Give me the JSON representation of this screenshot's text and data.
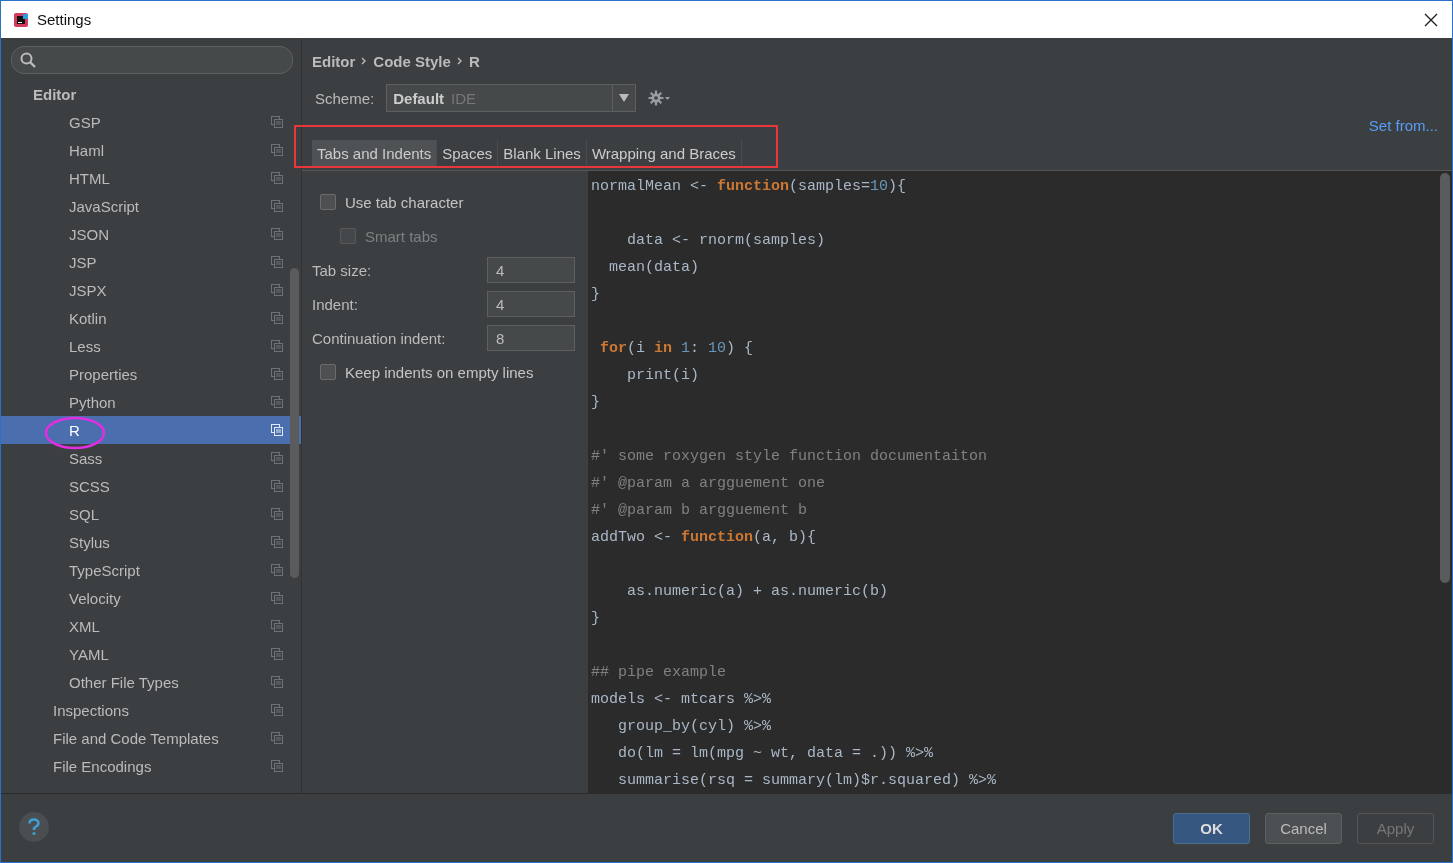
{
  "window": {
    "title": "Settings"
  },
  "sidebar": {
    "tree": [
      {
        "label": "Editor",
        "selected": false,
        "children": [
          {
            "children": [
              {
                "label": "GSP",
                "selected": false
              },
              {
                "label": "Haml",
                "selected": false
              },
              {
                "label": "HTML",
                "selected": false
              },
              {
                "label": "JavaScript",
                "selected": false
              },
              {
                "label": "JSON",
                "selected": false
              },
              {
                "label": "JSP",
                "selected": false
              },
              {
                "label": "JSPX",
                "selected": false
              },
              {
                "label": "Kotlin",
                "selected": false
              },
              {
                "label": "Less",
                "selected": false
              },
              {
                "label": "Properties",
                "selected": false
              },
              {
                "label": "Python",
                "selected": false
              },
              {
                "label": "R",
                "selected": true
              },
              {
                "label": "Sass",
                "selected": false
              },
              {
                "label": "SCSS",
                "selected": false
              },
              {
                "label": "SQL",
                "selected": false
              },
              {
                "label": "Stylus",
                "selected": false
              },
              {
                "label": "TypeScript",
                "selected": false
              },
              {
                "label": "Velocity",
                "selected": false
              },
              {
                "label": "XML",
                "selected": false
              },
              {
                "label": "YAML",
                "selected": false
              },
              {
                "label": "Other File Types",
                "selected": false
              }
            ]
          },
          {
            "label": "Inspections",
            "selected": false
          },
          {
            "label": "File and Code Templates",
            "selected": false
          },
          {
            "label": "File Encodings",
            "selected": false
          }
        ]
      }
    ]
  },
  "breadcrumb": [
    "Editor",
    "Code Style",
    "R"
  ],
  "scheme": {
    "label": "Scheme:",
    "value": "Default",
    "hint": "IDE"
  },
  "set_from": "Set from...",
  "tabs": [
    {
      "label": "Tabs and Indents",
      "selected": true
    },
    {
      "label": "Spaces",
      "selected": false
    },
    {
      "label": "Blank Lines",
      "selected": false
    },
    {
      "label": "Wrapping and Braces",
      "selected": false
    }
  ],
  "options": [
    {
      "kind": "checkbox",
      "label": "Use tab character",
      "checked": false,
      "disabled": false,
      "children": [
        {
          "kind": "checkbox",
          "label": "Smart tabs",
          "checked": false,
          "disabled": true
        }
      ]
    },
    {
      "kind": "number",
      "label": "Tab size:",
      "value": "4"
    },
    {
      "kind": "number",
      "label": "Indent:",
      "value": "4"
    },
    {
      "kind": "number",
      "label": "Continuation indent:",
      "value": "8"
    },
    {
      "kind": "checkbox",
      "label": "Keep indents on empty lines",
      "checked": false,
      "disabled": false
    }
  ],
  "code": [
    {
      "kind": "code",
      "tokens": [
        {
          "text": "normalMean <- ",
          "kind": "plain"
        },
        {
          "text": "function",
          "kind": "keyword"
        },
        {
          "text": "(samples=",
          "kind": "plain"
        },
        {
          "text": "10",
          "kind": "number"
        },
        {
          "text": "){",
          "kind": "plain"
        }
      ]
    },
    {
      "kind": "blank"
    },
    {
      "kind": "code",
      "tokens": [
        {
          "text": "    data <- rnorm(samples)",
          "kind": "plain"
        }
      ]
    },
    {
      "kind": "code",
      "tokens": [
        {
          "text": "  mean(data)",
          "kind": "plain"
        }
      ]
    },
    {
      "kind": "code",
      "tokens": [
        {
          "text": "}",
          "kind": "plain"
        }
      ]
    },
    {
      "kind": "blank"
    },
    {
      "kind": "code",
      "tokens": [
        {
          "text": " for",
          "kind": "keyword"
        },
        {
          "text": "(i ",
          "kind": "plain"
        },
        {
          "text": "in",
          "kind": "keyword"
        },
        {
          "text": " 1",
          "kind": "number"
        },
        {
          "text": ": ",
          "kind": "plain"
        },
        {
          "text": "10",
          "kind": "number"
        },
        {
          "text": ") {",
          "kind": "plain"
        }
      ]
    },
    {
      "kind": "code",
      "tokens": [
        {
          "text": "    print(i)",
          "kind": "plain"
        }
      ]
    },
    {
      "kind": "code",
      "tokens": [
        {
          "text": "}",
          "kind": "plain"
        }
      ]
    },
    {
      "kind": "blank"
    },
    {
      "kind": "code",
      "tokens": [
        {
          "text": "#' some roxygen style function documentaiton",
          "kind": "comment"
        }
      ]
    },
    {
      "kind": "code",
      "tokens": [
        {
          "text": "#' @param a argguement one",
          "kind": "comment"
        }
      ]
    },
    {
      "kind": "code",
      "tokens": [
        {
          "text": "#' @param b argguement b",
          "kind": "comment"
        }
      ]
    },
    {
      "kind": "code",
      "tokens": [
        {
          "text": "addTwo <- ",
          "kind": "plain"
        },
        {
          "text": "function",
          "kind": "keyword"
        },
        {
          "text": "(a, b){",
          "kind": "plain"
        }
      ]
    },
    {
      "kind": "blank"
    },
    {
      "kind": "code",
      "tokens": [
        {
          "text": "    as.numeric(a) + as.numeric(b)",
          "kind": "plain"
        }
      ]
    },
    {
      "kind": "code",
      "tokens": [
        {
          "text": "}",
          "kind": "plain"
        }
      ]
    },
    {
      "kind": "blank"
    },
    {
      "kind": "code",
      "tokens": [
        {
          "text": "## pipe example",
          "kind": "comment"
        }
      ]
    },
    {
      "kind": "code",
      "tokens": [
        {
          "text": "models <- mtcars %>%",
          "kind": "plain"
        }
      ]
    },
    {
      "kind": "code",
      "tokens": [
        {
          "text": "   group_by(cyl) %>%",
          "kind": "plain"
        }
      ]
    },
    {
      "kind": "code",
      "tokens": [
        {
          "text": "   do(lm = lm(mpg ~ wt, data = .)) %>%",
          "kind": "plain"
        }
      ]
    },
    {
      "kind": "code",
      "tokens": [
        {
          "text": "   summarise(rsq = summary(lm)$r.squared) %>%",
          "kind": "plain"
        }
      ]
    }
  ],
  "buttons": [
    {
      "label": "OK",
      "kind": "default",
      "disabled": false
    },
    {
      "label": "Cancel",
      "kind": "normal",
      "disabled": false
    },
    {
      "label": "Apply",
      "kind": "normal",
      "disabled": true
    }
  ]
}
